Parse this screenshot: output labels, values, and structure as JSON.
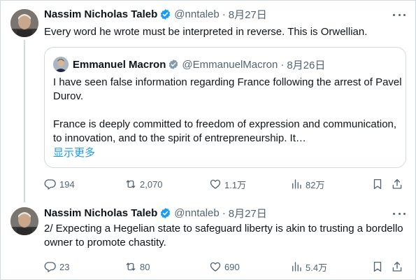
{
  "tweets": [
    {
      "author": {
        "name": "Nassim Nicholas Taleb",
        "handle": "@nntaleb",
        "verified": true
      },
      "time_separator": "·",
      "time": "8月27日",
      "text": "Every word he wrote must be interpreted in reverse. This is Orwellian.",
      "quote": {
        "author": {
          "name": "Emmanuel Macron",
          "handle": "@EmmanuelMacron",
          "verified": true
        },
        "time_separator": "·",
        "time": "8月26日",
        "text_p1": "I have seen false information regarding France following the arrest of Pavel Durov.",
        "text_p2": "France is deeply committed to freedom of expression and communication, to innovation, and to the spirit of entrepreneurship. It…",
        "show_more": "显示更多"
      },
      "stats": {
        "replies": "194",
        "retweets": "2,070",
        "likes": "1.1万",
        "views": "82万"
      }
    },
    {
      "author": {
        "name": "Nassim Nicholas Taleb",
        "handle": "@nntaleb",
        "verified": true
      },
      "time_separator": "·",
      "time": "8月27日",
      "text": "2/ Expecting a Hegelian state to safeguard liberty is akin to trusting a bordello owner to promote chastity.",
      "stats": {
        "replies": "23",
        "retweets": "80",
        "likes": "690",
        "views": "5.4万"
      }
    }
  ],
  "icons": {
    "verified": "verified-badge-icon",
    "more": "more-icon",
    "reply": "reply-icon",
    "retweet": "retweet-icon",
    "like": "like-icon",
    "views": "views-icon",
    "bookmark": "bookmark-icon",
    "share": "share-icon"
  },
  "colors": {
    "accent": "#1d9bf0",
    "text": "#0f1419",
    "muted": "#536471",
    "border": "#cfd9de"
  }
}
